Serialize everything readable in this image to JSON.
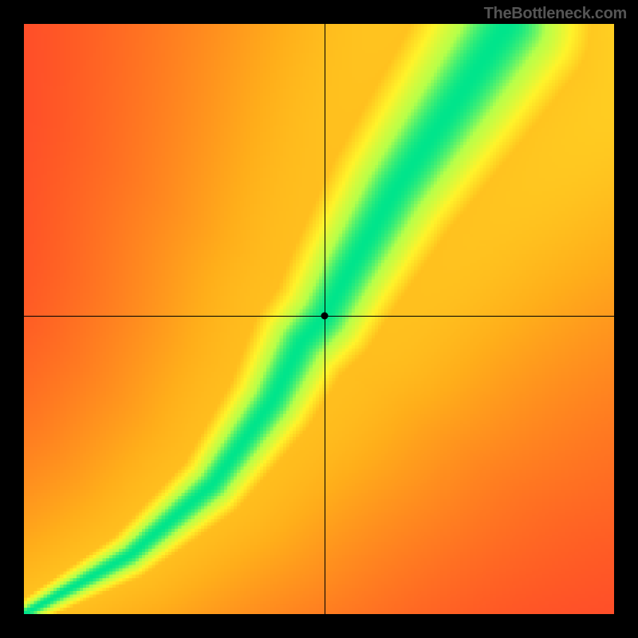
{
  "watermark": "TheBottleneck.com",
  "chart_data": {
    "type": "heatmap",
    "title": "",
    "xlabel": "",
    "ylabel": "",
    "xlim": [
      0,
      1
    ],
    "ylim": [
      0,
      1
    ],
    "grid": false,
    "resolution": 180,
    "crosshair": {
      "x": 0.51,
      "y": 0.505
    },
    "marker": {
      "x": 0.51,
      "y": 0.505,
      "color": "#000000"
    },
    "gradient_stops": [
      {
        "pos": 0.0,
        "color": "#ff193b"
      },
      {
        "pos": 0.2,
        "color": "#ff5a25"
      },
      {
        "pos": 0.45,
        "color": "#ffae1a"
      },
      {
        "pos": 0.7,
        "color": "#fff32a"
      },
      {
        "pos": 0.88,
        "color": "#b6ff4a"
      },
      {
        "pos": 1.0,
        "color": "#00e58b"
      }
    ],
    "ridge": {
      "comment": "Optimal-balance curve (green ridge) from bottom-left to top-right; nonlinear S-shape.",
      "points": [
        {
          "x": 0.0,
          "y": 0.0
        },
        {
          "x": 0.18,
          "y": 0.1
        },
        {
          "x": 0.32,
          "y": 0.22
        },
        {
          "x": 0.42,
          "y": 0.36
        },
        {
          "x": 0.47,
          "y": 0.46
        },
        {
          "x": 0.51,
          "y": 0.505
        },
        {
          "x": 0.55,
          "y": 0.58
        },
        {
          "x": 0.63,
          "y": 0.72
        },
        {
          "x": 0.74,
          "y": 0.88
        },
        {
          "x": 0.82,
          "y": 1.0
        }
      ],
      "half_width_start": 0.012,
      "half_width_end": 0.08
    },
    "background_bias": {
      "comment": "Far from the ridge, field warms diagonally opposite of the ridge direction; upper-right and lower-left are warmer/yellower than flat red corners.",
      "lower_left_boost": 0.0,
      "upper_right_boost": 0.35
    }
  }
}
